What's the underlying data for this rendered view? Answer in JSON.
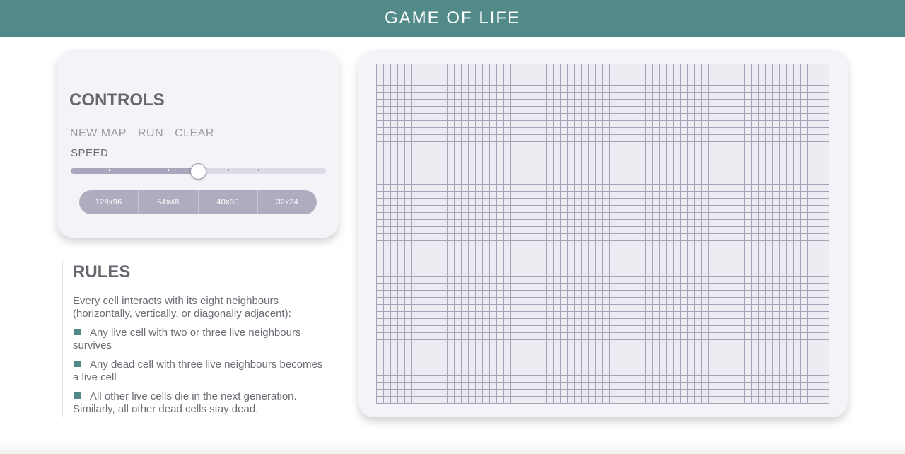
{
  "header": {
    "title": "GAME OF LIFE"
  },
  "controls": {
    "title": "CONTROLS",
    "actions": [
      {
        "label": "NEW MAP",
        "name": "new-map-button"
      },
      {
        "label": "RUN",
        "name": "run-button"
      },
      {
        "label": "CLEAR",
        "name": "clear-button"
      }
    ],
    "speed_label": "SPEED",
    "speed": {
      "min": 0,
      "max": 8,
      "value": 4
    },
    "sizes": [
      "128x96",
      "64x48",
      "40x30",
      "32x24"
    ]
  },
  "rules": {
    "title": "RULES",
    "intro": "Every cell interacts with its eight neighbours (horizontally, vertically, or diagonally adjacent):",
    "items": [
      "Any live cell with two or three live neighbours survives",
      "Any dead cell with three live neighbours becomes a live cell",
      "All other live cells die in the next generation. Similarly, all other dead cells stay dead."
    ]
  },
  "board": {
    "columns": 64,
    "rows": 48
  },
  "colors": {
    "accent": "#518a88",
    "card": "#f4f3f8",
    "slider_fill": "#aba6bb",
    "size_group": "#b1abbf",
    "grid_line": "#a7a3b6"
  }
}
